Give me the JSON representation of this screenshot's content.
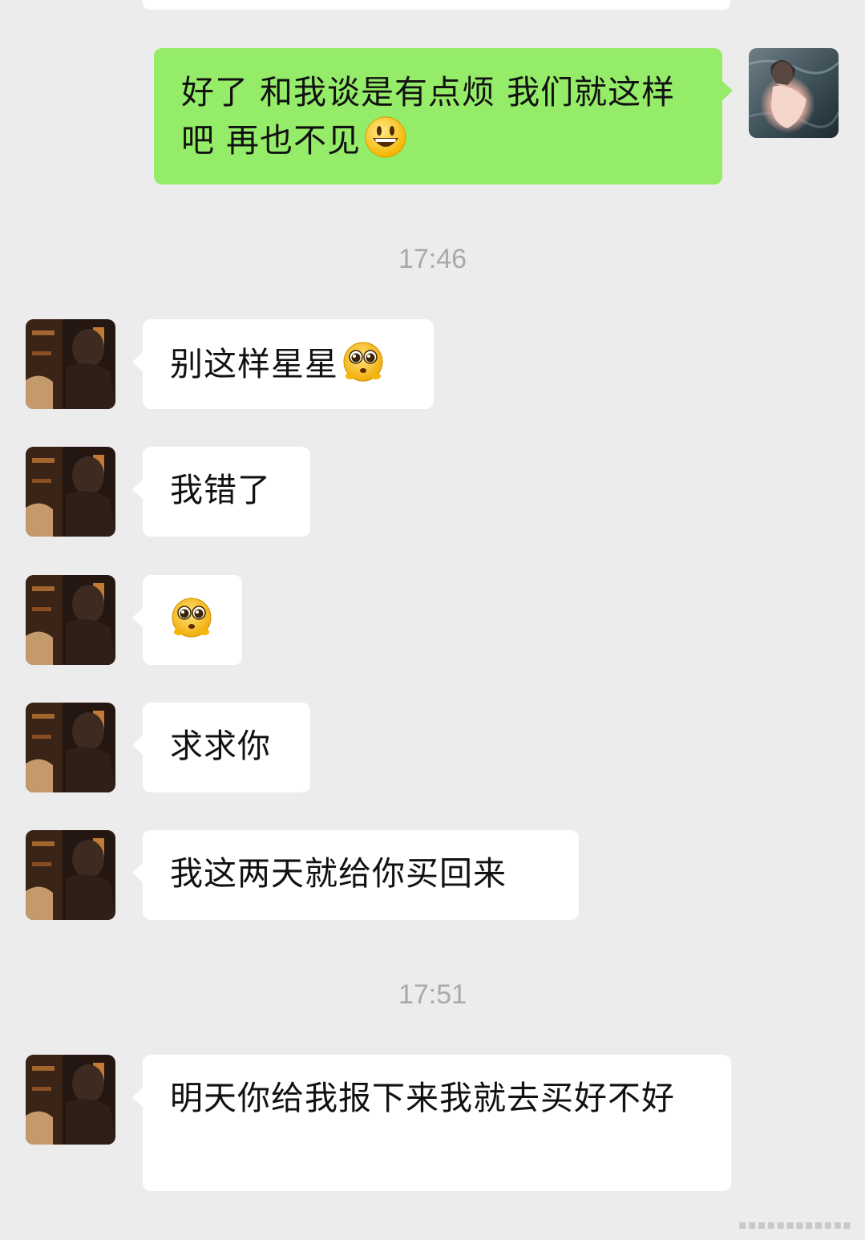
{
  "messages": [
    {
      "id": "m1",
      "side": "right",
      "text": "好了 和我谈是有点烦 我们就这样吧 再也不见",
      "emoji": "grinning-face-emoji"
    },
    {
      "id": "m2",
      "side": "left",
      "text": "别这样星星",
      "emoji": "pleading-face-emoji"
    },
    {
      "id": "m3",
      "side": "left",
      "text": "我错了",
      "emoji": ""
    },
    {
      "id": "m4",
      "side": "left",
      "text": "",
      "emoji": "pleading-face-emoji"
    },
    {
      "id": "m5",
      "side": "left",
      "text": "求求你",
      "emoji": ""
    },
    {
      "id": "m6",
      "side": "left",
      "text": "我这两天就给你买回来",
      "emoji": ""
    },
    {
      "id": "m7",
      "side": "left",
      "text": "明天你给我报下来我就去买好不好",
      "emoji": ""
    }
  ],
  "timestamps": {
    "t1": "17:46",
    "t2": "17:51"
  },
  "colors": {
    "background": "#ececec",
    "outgoing_bubble": "#95ec69",
    "incoming_bubble": "#ffffff",
    "timestamp_text": "#a9a9a9"
  }
}
